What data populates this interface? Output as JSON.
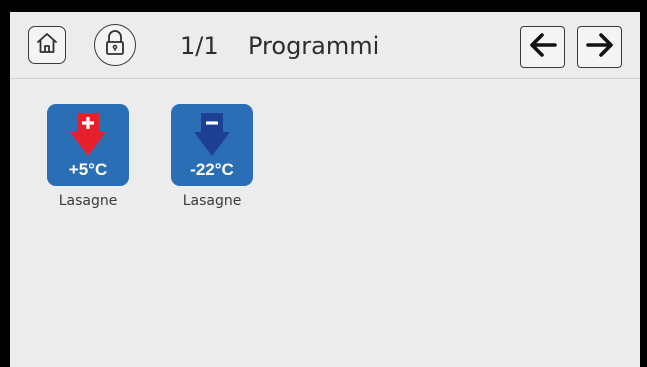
{
  "header": {
    "page_indicator": "1/1",
    "title": "Programmi",
    "icons": {
      "home": "home-icon",
      "lock": "padlock-icon",
      "back": "arrow-left-icon",
      "forward": "arrow-right-icon"
    }
  },
  "programs": [
    {
      "temperature": "+5°C",
      "name": "Lasagne",
      "icon": "arrow-down-plus-icon",
      "arrow_color": "#e8202e"
    },
    {
      "temperature": "-22°C",
      "name": "Lasagne",
      "icon": "arrow-down-minus-icon",
      "arrow_color": "#1f3f94"
    }
  ],
  "colors": {
    "background": "#ececec",
    "tile": "#2a6fb5",
    "text": "#2d2d2d"
  }
}
